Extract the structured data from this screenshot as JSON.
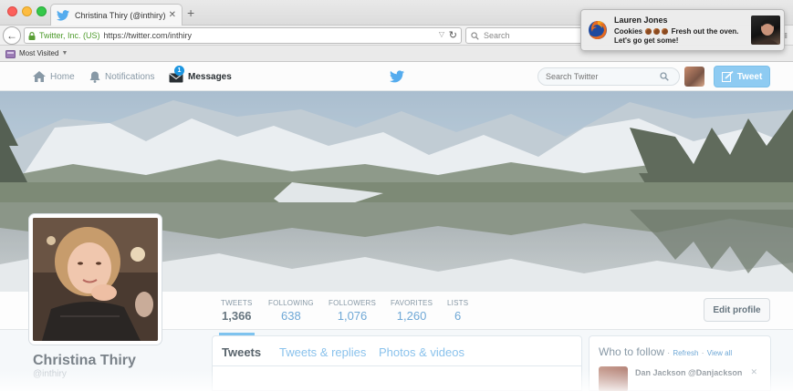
{
  "browser": {
    "tab_title": "Christina Thiry (@inthiry) | T...",
    "url_org": "Twitter, Inc. (US)",
    "url": "https://twitter.com/inthiry",
    "search_placeholder": "Search",
    "bookmark_label": "Most Visited"
  },
  "twitter_nav": {
    "home": "Home",
    "notifications": "Notifications",
    "messages": "Messages",
    "messages_badge": "1",
    "search_placeholder": "Search Twitter",
    "tweet_button": "Tweet"
  },
  "profile": {
    "name": "Christina Thiry",
    "handle": "@inthiry",
    "edit_button": "Edit profile",
    "stats": [
      {
        "label": "TWEETS",
        "value": "1,366"
      },
      {
        "label": "FOLLOWING",
        "value": "638"
      },
      {
        "label": "FOLLOWERS",
        "value": "1,076"
      },
      {
        "label": "FAVORITES",
        "value": "1,260"
      },
      {
        "label": "LISTS",
        "value": "6"
      }
    ]
  },
  "timeline_tabs": [
    "Tweets",
    "Tweets & replies",
    "Photos & videos"
  ],
  "who_to_follow": {
    "title": "Who to follow",
    "separator": "·",
    "refresh": "Refresh",
    "view_all": "View all",
    "first_suggestion": "Dan Jackson @Danjackson"
  },
  "notification": {
    "sender": "Lauren Jones",
    "line1_prefix": "Cookies",
    "line1_suffix": "Fresh out the oven.",
    "line2": "Let's go get some!"
  },
  "colors": {
    "twitter_blue": "#55acee",
    "tweet_button": "#8ecbf2",
    "link": "#6fa8d6"
  }
}
